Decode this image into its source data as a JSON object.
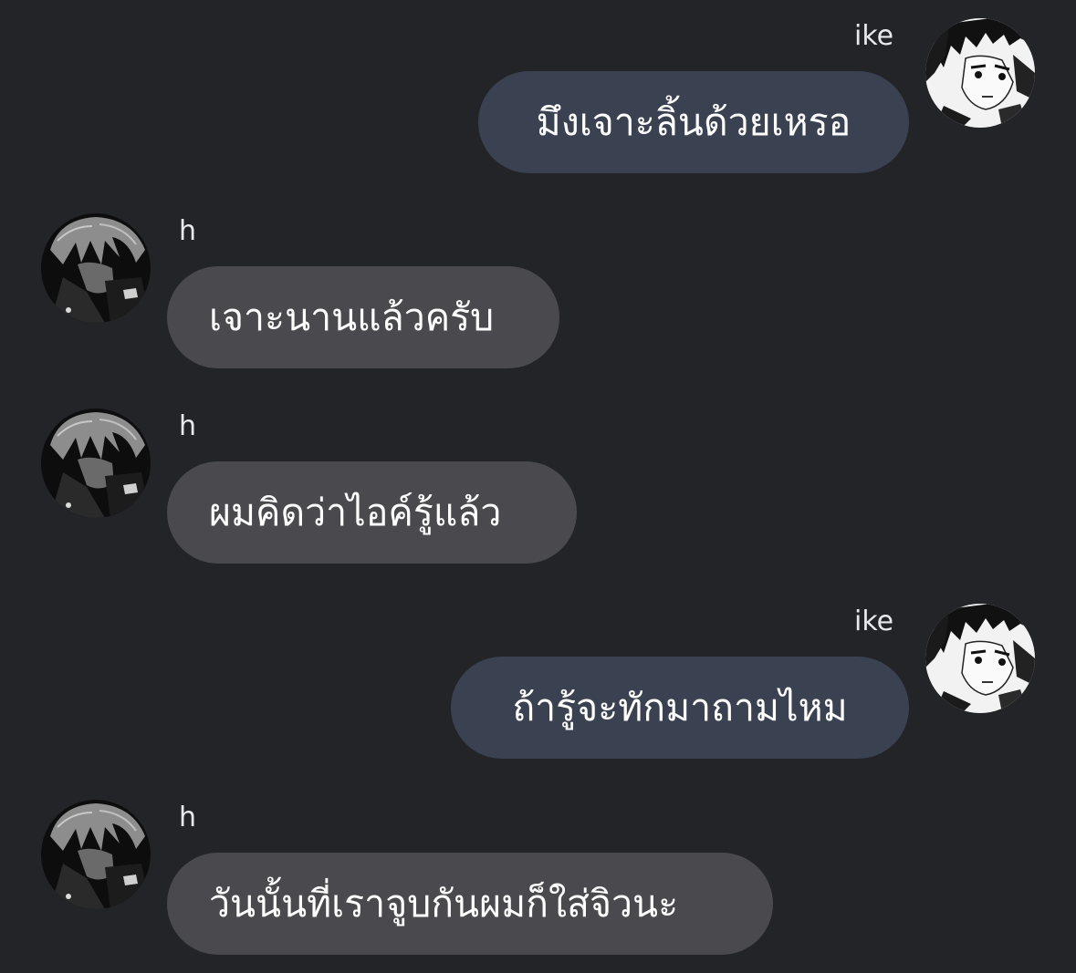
{
  "colors": {
    "background": "#232428",
    "outgoing_bubble": "#3a4150",
    "incoming_bubble": "#4a4a4e",
    "text": "#ffffff"
  },
  "users": {
    "me": {
      "name": "ike",
      "avatar_icon": "manga-boy-avatar-icon"
    },
    "other": {
      "name": "h",
      "avatar_icon": "gray-haired-boy-avatar-icon"
    }
  },
  "messages": [
    {
      "from": "ike",
      "text": "มึงเจาะลิ้นด้วยเหรอ"
    },
    {
      "from": "h",
      "text": "เจาะนานแล้วครับ"
    },
    {
      "from": "h",
      "text": "ผมคิดว่าไอค์รู้แล้ว"
    },
    {
      "from": "ike",
      "text": "ถ้ารู้จะทักมาถามไหม"
    },
    {
      "from": "h",
      "text": "วันนั้นที่เราจูบกันผมก็ใส่จิวนะ"
    }
  ]
}
